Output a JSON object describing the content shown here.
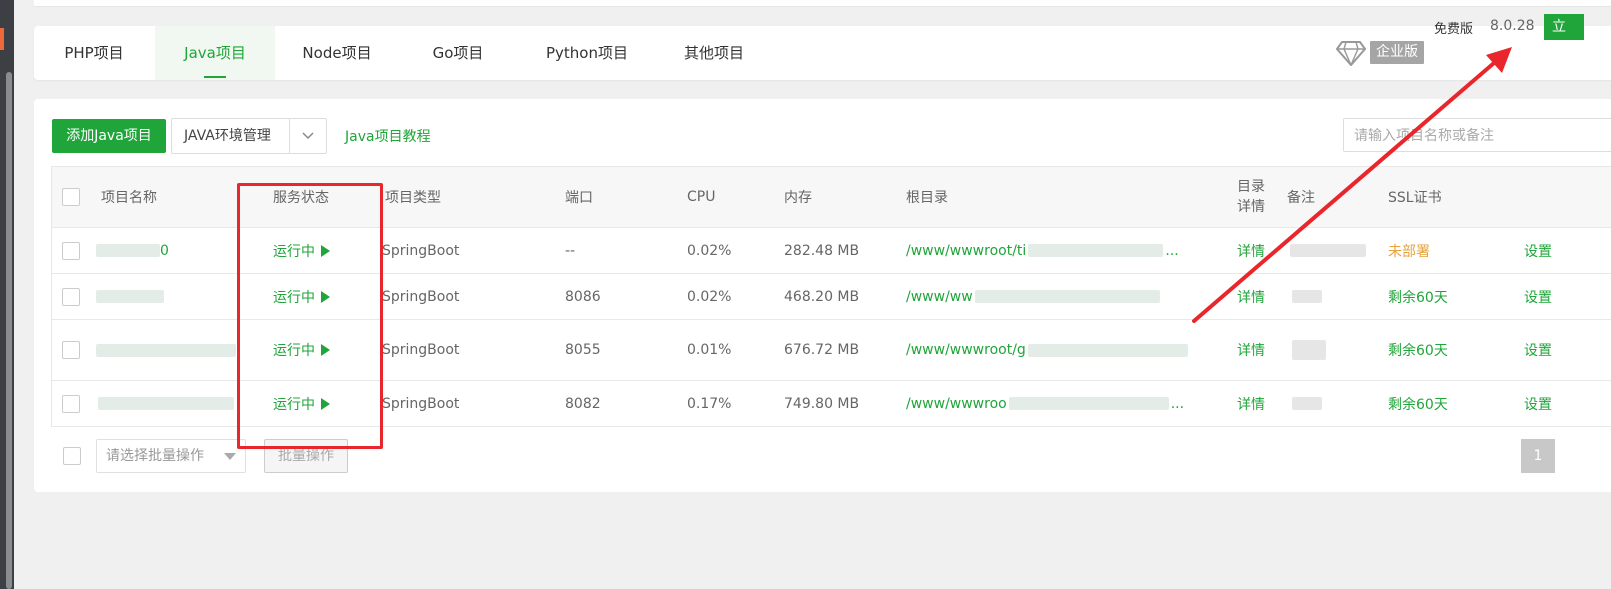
{
  "tabs": [
    {
      "label": "PHP项目",
      "active": false
    },
    {
      "label": "Java项目",
      "active": true
    },
    {
      "label": "Node项目",
      "active": false
    },
    {
      "label": "Go项目",
      "active": false
    },
    {
      "label": "Python项目",
      "active": false
    },
    {
      "label": "其他项目",
      "active": false
    }
  ],
  "header": {
    "edition_badge": "企业版",
    "free_label": "免费版",
    "version": "8.0.28",
    "update_button": "立"
  },
  "toolbar": {
    "add_button": "添加Java项目",
    "env_button": "JAVA环境管理",
    "tutorial_link": "Java项目教程",
    "search_placeholder": "请输入项目名称或备注"
  },
  "table": {
    "columns": {
      "name": "项目名称",
      "status": "服务状态",
      "type": "项目类型",
      "port": "端口",
      "cpu": "CPU",
      "mem": "内存",
      "root": "根目录",
      "dir_detail": "目录详情",
      "note": "备注",
      "ssl": "SSL证书"
    },
    "rows": [
      {
        "name": "0",
        "status": "运行中",
        "type": "SpringBoot",
        "port": "--",
        "cpu": "0.02%",
        "mem": "282.48 MB",
        "root": "/www/wwwroot/ti",
        "root_suffix": "...",
        "detail": "详情",
        "ssl": "未部署",
        "ssl_state": "none",
        "action": "设置"
      },
      {
        "name": "",
        "status": "运行中",
        "type": "SpringBoot",
        "port": "8086",
        "cpu": "0.02%",
        "mem": "468.20 MB",
        "root": "/www/ww",
        "root_suffix": "",
        "detail": "详情",
        "ssl": "剩余60天",
        "ssl_state": "ok",
        "action": "设置"
      },
      {
        "name": "",
        "status": "运行中",
        "type": "SpringBoot",
        "port": "8055",
        "cpu": "0.01%",
        "mem": "676.72 MB",
        "root": "/www/wwwroot/g",
        "root_suffix": "",
        "detail": "详情",
        "ssl": "剩余60天",
        "ssl_state": "ok",
        "action": "设置"
      },
      {
        "name": "",
        "status": "运行中",
        "type": "SpringBoot",
        "port": "8082",
        "cpu": "0.17%",
        "mem": "749.80 MB",
        "root": "/www/wwwroo",
        "root_suffix": "...",
        "detail": "详情",
        "ssl": "剩余60天",
        "ssl_state": "ok",
        "action": "设置"
      }
    ]
  },
  "footer": {
    "batch_placeholder": "请选择批量操作",
    "batch_button": "批量操作",
    "current_page": "1"
  },
  "colors": {
    "accent": "#20a53a",
    "warning": "#e6a23c",
    "annotation": "#e8262c"
  }
}
